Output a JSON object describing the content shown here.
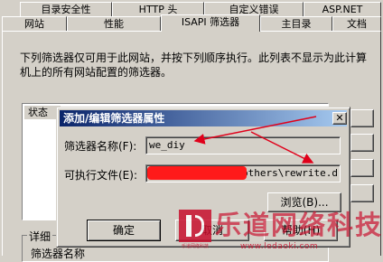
{
  "tabs_row1": [
    "目录安全性",
    "HTTP 头",
    "自定义错误",
    "ASP.NET"
  ],
  "tabs_row2": [
    "网站",
    "性能",
    "ISAPI 筛选器",
    "主目录",
    "文档"
  ],
  "description": "下列筛选器仅可用于此网站，并按下列顺序执行。此列表不显示为此计算机上的所有网站配置的筛选器。",
  "list_header_status": "状态",
  "details_label": "详细",
  "details_partial": "筛选器名称",
  "dialog": {
    "title": "添加/编辑筛选器属性",
    "close_glyph": "✕",
    "filter_name_label": "筛选器名称(F):",
    "filter_name_value": "we_diy",
    "exe_label": "可执行文件(E):",
    "exe_value": "\\others\\rewrite.d",
    "browse_label": "浏览(B)...",
    "ok_label": "确定",
    "cancel_label": "取消",
    "help_label": "帮助(H)"
  },
  "watermark": {
    "logo_text": "乐道网络科技",
    "logo_sub": "乐道网络科技",
    "url": "www.ledaoki.com"
  },
  "colors": {
    "arrow": "#e0001a",
    "redaction": "#ff1a1a",
    "title_start": "#0a246a",
    "title_end": "#a6caf0"
  }
}
